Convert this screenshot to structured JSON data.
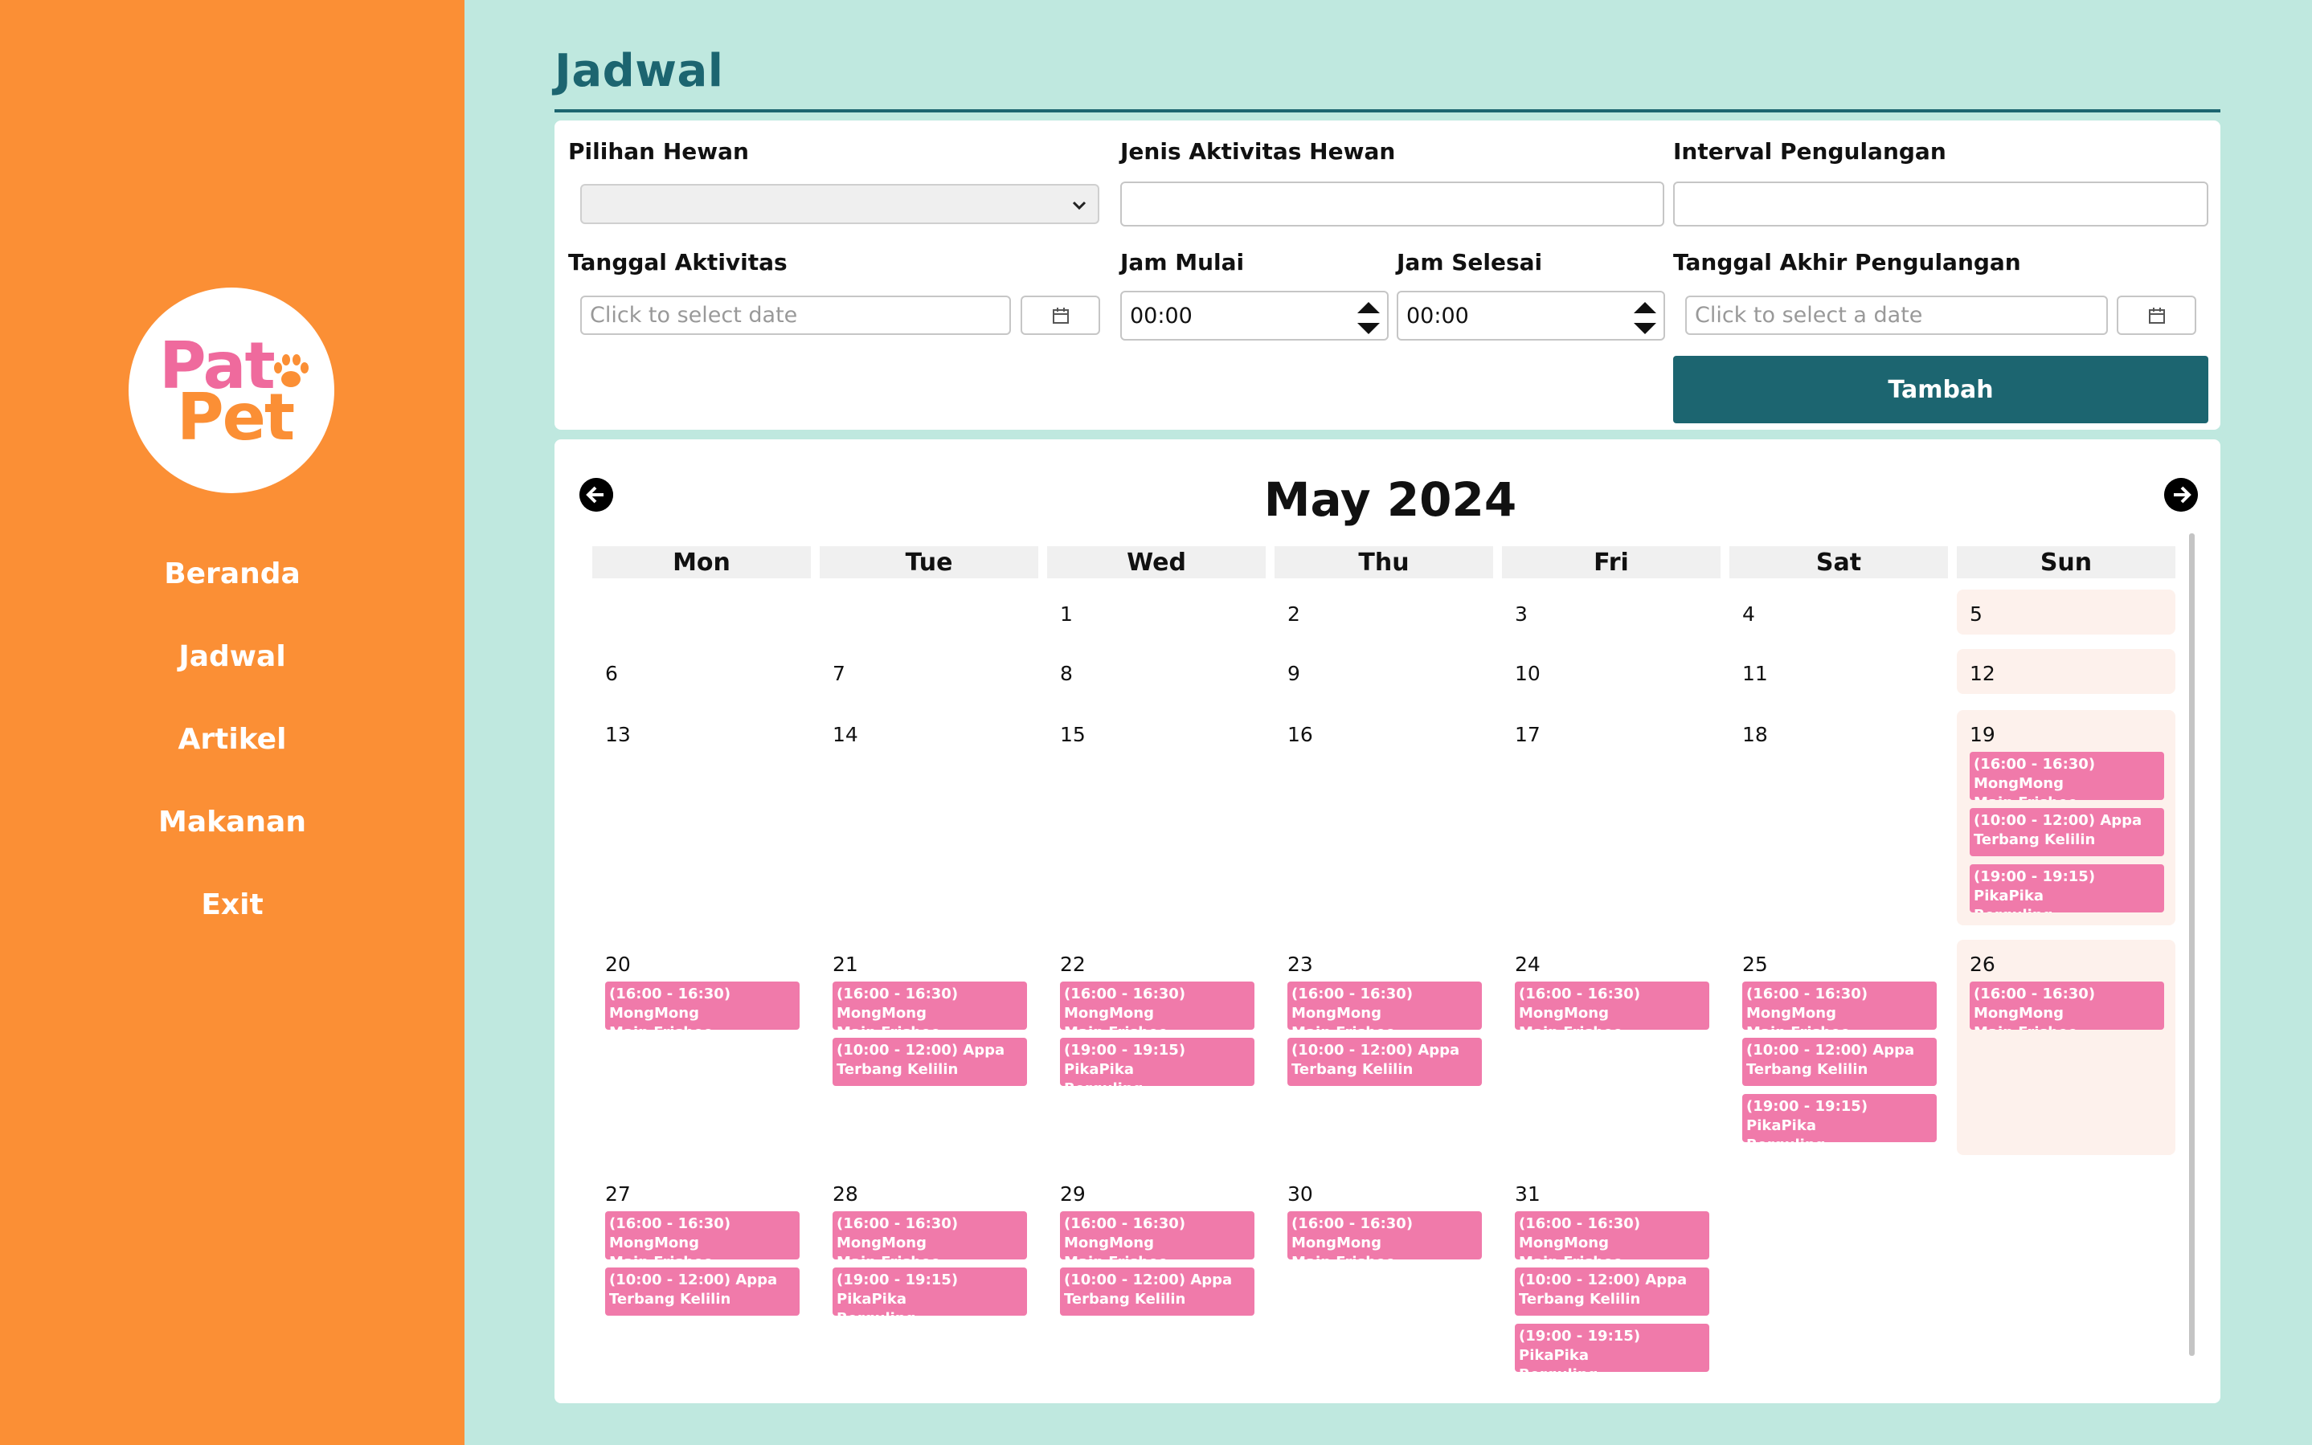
{
  "logo": {
    "line1": "Pat",
    "line2": "Pet"
  },
  "nav": [
    {
      "label": "Beranda"
    },
    {
      "label": "Jadwal"
    },
    {
      "label": "Artikel"
    },
    {
      "label": "Makanan"
    },
    {
      "label": "Exit"
    }
  ],
  "page_title": "Jadwal",
  "form": {
    "pet_label": "Pilihan Hewan",
    "pet_value": "",
    "activity_label": "Jenis Aktivitas Hewan",
    "activity_value": "",
    "interval_label": "Interval Pengulangan",
    "interval_value": "",
    "date_label": "Tanggal Aktivitas",
    "date_placeholder": "Click to select date",
    "start_label": "Jam Mulai",
    "start_value": "00:00",
    "end_label": "Jam Selesai",
    "end_value": "00:00",
    "repeat_end_label": "Tanggal Akhir Pengulangan",
    "repeat_end_placeholder": "Click to select a date",
    "submit_label": "Tambah"
  },
  "calendar": {
    "month_title": "May 2024",
    "weekdays": [
      "Mon",
      "Tue",
      "Wed",
      "Thu",
      "Fri",
      "Sat",
      "Sun"
    ],
    "weeks": [
      [
        null,
        null,
        {
          "day": "1",
          "events": []
        },
        {
          "day": "2",
          "events": []
        },
        {
          "day": "3",
          "events": []
        },
        {
          "day": "4",
          "events": []
        },
        {
          "day": "5",
          "events": []
        }
      ],
      [
        {
          "day": "6",
          "events": []
        },
        {
          "day": "7",
          "events": []
        },
        {
          "day": "8",
          "events": []
        },
        {
          "day": "9",
          "events": []
        },
        {
          "day": "10",
          "events": []
        },
        {
          "day": "11",
          "events": []
        },
        {
          "day": "12",
          "events": []
        }
      ],
      [
        {
          "day": "13",
          "events": []
        },
        {
          "day": "14",
          "events": []
        },
        {
          "day": "15",
          "events": []
        },
        {
          "day": "16",
          "events": []
        },
        {
          "day": "17",
          "events": []
        },
        {
          "day": "18",
          "events": []
        },
        {
          "day": "19",
          "events": [
            {
              "line1": "(16:00 - 16:30) MongMong",
              "line2": "Main Frisbee"
            },
            {
              "line1": "(10:00 - 12:00) Appa",
              "line2": "Terbang Kelilin"
            },
            {
              "line1": "(19:00 - 19:15) PikaPika",
              "line2": "Berguling"
            }
          ]
        }
      ],
      [
        {
          "day": "20",
          "events": [
            {
              "line1": "(16:00 - 16:30) MongMong",
              "line2": "Main Frisbee"
            }
          ]
        },
        {
          "day": "21",
          "events": [
            {
              "line1": "(16:00 - 16:30) MongMong",
              "line2": "Main Frisbee"
            },
            {
              "line1": "(10:00 - 12:00) Appa",
              "line2": "Terbang Kelilin"
            }
          ]
        },
        {
          "day": "22",
          "events": [
            {
              "line1": "(16:00 - 16:30) MongMong",
              "line2": "Main Frisbee"
            },
            {
              "line1": "(19:00 - 19:15) PikaPika",
              "line2": "Berguling"
            }
          ]
        },
        {
          "day": "23",
          "events": [
            {
              "line1": "(16:00 - 16:30) MongMong",
              "line2": "Main Frisbee"
            },
            {
              "line1": "(10:00 - 12:00) Appa",
              "line2": "Terbang Kelilin"
            }
          ]
        },
        {
          "day": "24",
          "events": [
            {
              "line1": "(16:00 - 16:30) MongMong",
              "line2": "Main Frisbee"
            }
          ]
        },
        {
          "day": "25",
          "events": [
            {
              "line1": "(16:00 - 16:30) MongMong",
              "line2": "Main Frisbee"
            },
            {
              "line1": "(10:00 - 12:00) Appa",
              "line2": "Terbang Kelilin"
            },
            {
              "line1": "(19:00 - 19:15) PikaPika",
              "line2": "Berguling"
            }
          ]
        },
        {
          "day": "26",
          "events": [
            {
              "line1": "(16:00 - 16:30) MongMong",
              "line2": "Main Frisbee"
            }
          ]
        }
      ],
      [
        {
          "day": "27",
          "events": [
            {
              "line1": "(16:00 - 16:30) MongMong",
              "line2": "Main Frisbee"
            },
            {
              "line1": "(10:00 - 12:00) Appa",
              "line2": "Terbang Kelilin"
            }
          ]
        },
        {
          "day": "28",
          "events": [
            {
              "line1": "(16:00 - 16:30) MongMong",
              "line2": "Main Frisbee"
            },
            {
              "line1": "(19:00 - 19:15) PikaPika",
              "line2": "Berguling"
            }
          ]
        },
        {
          "day": "29",
          "events": [
            {
              "line1": "(16:00 - 16:30) MongMong",
              "line2": "Main Frisbee"
            },
            {
              "line1": "(10:00 - 12:00) Appa",
              "line2": "Terbang Kelilin"
            }
          ]
        },
        {
          "day": "30",
          "events": [
            {
              "line1": "(16:00 - 16:30) MongMong",
              "line2": "Main Frisbee"
            }
          ]
        },
        {
          "day": "31",
          "events": [
            {
              "line1": "(16:00 - 16:30) MongMong",
              "line2": "Main Frisbee"
            },
            {
              "line1": "(10:00 - 12:00) Appa",
              "line2": "Terbang Kelilin"
            },
            {
              "line1": "(19:00 - 19:15) PikaPika",
              "line2": "Berguling"
            }
          ]
        },
        null,
        null
      ]
    ]
  },
  "icons": {
    "prev": "arrow-left-icon",
    "next": "arrow-right-icon",
    "calendar": "calendar-icon",
    "dropdown": "chevron-down-icon"
  },
  "colors": {
    "sidebar": "#fb8f35",
    "background": "#bfe8df",
    "primary": "#1c6570",
    "event": "#f07aaa",
    "sunday": "#fdf1ec",
    "logo_pink": "#ef6a9d"
  }
}
